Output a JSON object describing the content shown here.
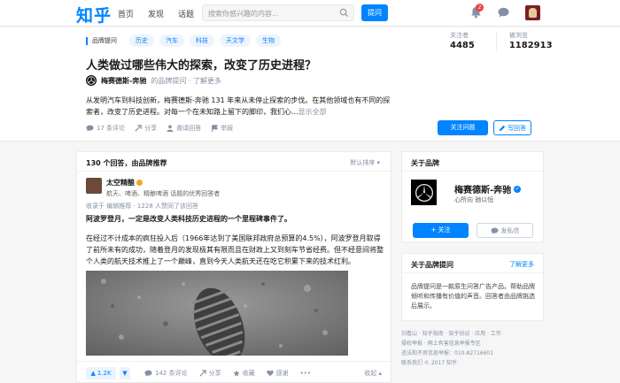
{
  "header": {
    "logo": "知乎",
    "nav": [
      "首页",
      "发现",
      "话题"
    ],
    "search_placeholder": "搜索你感兴趣的内容...",
    "ask_label": "提问",
    "notification_count": "2"
  },
  "question": {
    "brand_tag": "品牌提问",
    "topics": [
      "历史",
      "汽车",
      "科技",
      "天文学",
      "生物"
    ],
    "followers_label": "关注者",
    "followers_value": "4485",
    "views_label": "被浏览",
    "views_value": "1182913",
    "title": "人类做过哪些伟大的探索，改变了历史进程？",
    "asker_name": "梅赛德斯-奔驰",
    "asker_role": "的品牌提问 · 了解更多",
    "description": "从发明汽车到科技创新，梅赛德斯-奔驰 131 年来从未停止探索的步伐。在其他领域也有不同的探索者，改变了历史进程。对每一个在未知路上留下的脚印，我们心...",
    "show_all": "显示全部",
    "actions": {
      "comments": "17 条评论",
      "share": "分享",
      "invite": "邀请回答",
      "report": "举报"
    },
    "follow_label": "关注问题",
    "write_label": "写回答"
  },
  "answers": {
    "count_label": "130 个回答，由品牌推荐",
    "sort_label": "默认排序",
    "author_name": "太空精酿",
    "author_bio": "航天、啤酒、精酿啤酒 话题的优秀回答者",
    "upvoters": "收录于 编辑推荐 · 1228 人赞同了该回答",
    "lead": "阿波罗登月，一定是改变人类科技历史进程的一个里程碑事件了。",
    "body": "在经过不计成本的疯狂投入后（1966年达到了美国联邦政府总预算的4.5%），阿波罗登月取得了前所未有的成功，随着登月的发现极其有限而且在财政上又到刻车节省经费。但不经意间将整个人类的航天技术推上了一个巅峰，直到今天人类航天还在吃它积累下来的技术红利。",
    "vote_count": "1.2K",
    "bar": {
      "comments": "142 条评论",
      "share": "分享",
      "collect": "收藏",
      "thanks": "感谢"
    },
    "fold_label": "收起"
  },
  "sidebar": {
    "brand_section_title": "关于品牌",
    "brand_name": "梅赛德斯-奔驰",
    "brand_slogan": "心所向 驰以恒",
    "follow_label": "+ 关注",
    "message_label": "发私信",
    "about_title": "关于品牌提问",
    "about_more": "了解更多",
    "about_text": "品牌提问是一款原生问答广告产品。帮助品牌倾听和传播有价值的声音。回答者由品牌挑选后展示。",
    "footer_lines": [
      "刘看山 · 知乎指南 · 知乎协议 · 应用 · 工作",
      "侵权举报 · 网上有害信息举报专区",
      "违法和不良信息举报：010-82716601",
      "联系我们 © 2017 知乎"
    ]
  },
  "colors": {
    "brand_blue": "#0084ff",
    "muted": "#8590a6"
  }
}
